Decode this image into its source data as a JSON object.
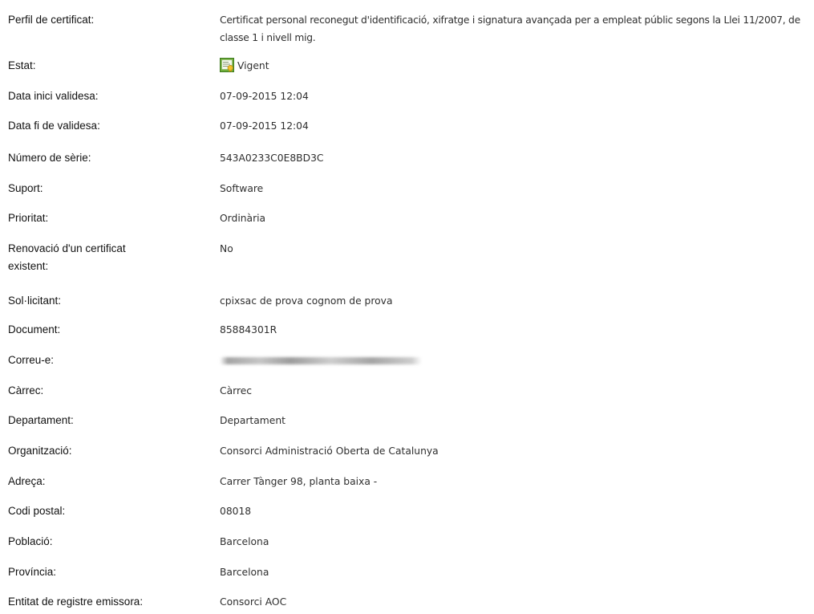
{
  "certificate_detail": {
    "perfil": {
      "label": "Perfil de certificat:",
      "value": "Certificat personal reconegut d'identificació, xifratge i signatura avançada per a empleat públic segons la Llei 11/2007, de classe 1 i nivell mig."
    },
    "estat": {
      "label": "Estat:",
      "value": "Vigent",
      "icon": "certificate-valid-icon"
    },
    "data_inici": {
      "label": "Data inici validesa:",
      "value": "07-09-2015 12:04"
    },
    "data_fi": {
      "label": "Data fi de validesa:",
      "value": "07-09-2015 12:04"
    },
    "numero_serie": {
      "label": "Número de sèrie:",
      "value": "543A0233C0E8BD3C"
    },
    "suport": {
      "label": "Suport:",
      "value": "Software"
    },
    "prioritat": {
      "label": "Prioritat:",
      "value": "Ordinària"
    },
    "renovacio": {
      "label": "Renovació d'un certificat existent:",
      "value": "No"
    },
    "sollicitant": {
      "label": "Sol·licitant:",
      "value": "cpixsac de prova cognom de prova"
    },
    "document": {
      "label": "Document:",
      "value": "85884301R"
    },
    "correu": {
      "label": "Correu-e:"
    },
    "carrec": {
      "label": "Càrrec:",
      "value": "Càrrec"
    },
    "departament": {
      "label": "Departament:",
      "value": "Departament"
    },
    "organitzacio": {
      "label": "Organització:",
      "value": "Consorci Administració Oberta de Catalunya"
    },
    "adreca": {
      "label": "Adreça:",
      "value": "Carrer Tànger 98, planta baixa -"
    },
    "codi_postal": {
      "label": "Codi postal:",
      "value": "08018"
    },
    "poblacio": {
      "label": "Població:",
      "value": "Barcelona"
    },
    "provincia": {
      "label": "Província:",
      "value": "Barcelona"
    },
    "entitat_registre": {
      "label": "Entitat de registre emissora:",
      "value": "Consorci AOC"
    }
  }
}
